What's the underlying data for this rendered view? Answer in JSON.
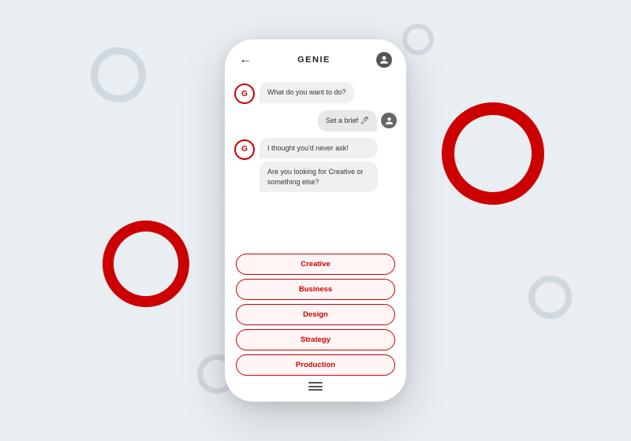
{
  "background": {
    "color": "#e8eef2"
  },
  "header": {
    "title": "GENIE",
    "back_label": "←"
  },
  "chat": {
    "bot_messages_1": [
      {
        "text": "What do you want to do?"
      }
    ],
    "user_message": "Set a brief 🖊",
    "bot_messages_2": [
      {
        "text": "I thought you'd never ask!"
      },
      {
        "text": "Are you looking for Creative or something else?"
      }
    ]
  },
  "options": [
    {
      "label": "Creative"
    },
    {
      "label": "Business"
    },
    {
      "label": "Design"
    },
    {
      "label": "Strategy"
    },
    {
      "label": "Production"
    }
  ],
  "icons": {
    "back": "←",
    "menu": "≡"
  }
}
